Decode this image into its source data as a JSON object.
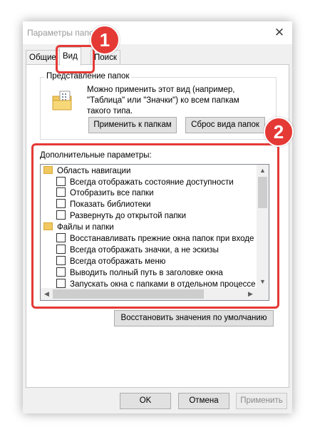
{
  "window": {
    "title": "Параметры папок",
    "close_glyph": "✕"
  },
  "tabs": [
    {
      "label": "Общие"
    },
    {
      "label": "Вид"
    },
    {
      "label": "Поиск"
    }
  ],
  "folder_views": {
    "group_title": "Представление папок",
    "description": "Можно применить этот вид (например, \"Таблица\" или \"Значки\") ко всем папкам такого типа.",
    "apply_button": "Применить к папкам",
    "reset_button": "Сброс вида папок"
  },
  "advanced": {
    "label": "Дополнительные параметры:",
    "items": [
      {
        "type": "folder",
        "text": "Область навигации"
      },
      {
        "type": "checkbox",
        "text": "Всегда отображать состояние доступности"
      },
      {
        "type": "checkbox",
        "text": "Отобразить все папки"
      },
      {
        "type": "checkbox",
        "text": "Показать библиотеки"
      },
      {
        "type": "checkbox",
        "text": "Развернуть до открытой папки"
      },
      {
        "type": "folder",
        "text": "Файлы и папки"
      },
      {
        "type": "checkbox",
        "text": "Восстанавливать прежние окна папок при входе в си"
      },
      {
        "type": "checkbox",
        "text": "Всегда отображать значки, а не эскизы"
      },
      {
        "type": "checkbox",
        "text": "Всегда отображать меню"
      },
      {
        "type": "checkbox",
        "text": "Выводить полный путь в заголовке окна"
      },
      {
        "type": "checkbox",
        "text": "Запускать окна с папками в отдельном процессе"
      }
    ]
  },
  "restore_defaults": "Восстановить значения по умолчанию",
  "footer": {
    "ok": "OK",
    "cancel": "Отмена",
    "apply": "Применить"
  },
  "annotations": {
    "badge1": "1",
    "badge2": "2"
  },
  "colors": {
    "accent": "#e53935"
  }
}
